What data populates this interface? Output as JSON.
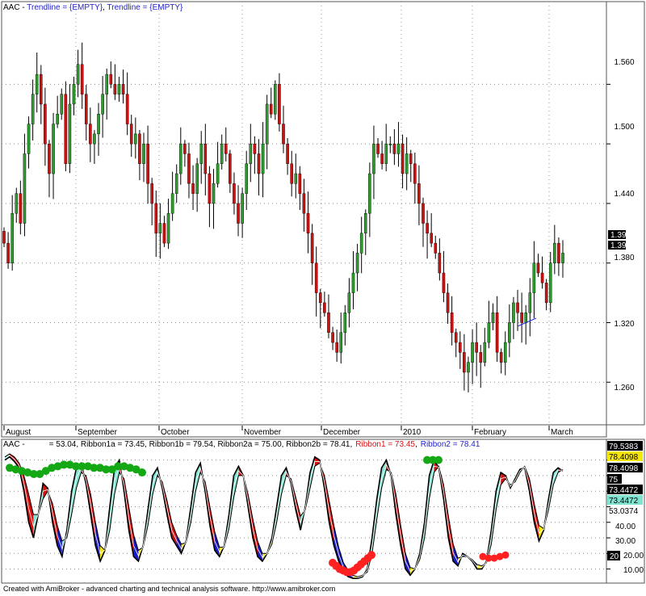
{
  "top_panel": {
    "symbol_label": "AAC - ",
    "trendline_text_1": "Trendline = {EMPTY}",
    "separator": ", ",
    "trendline_text_2": "Trendline = {EMPTY}",
    "price_labels": [
      "1.560",
      "1.500",
      "1.440",
      "1.380",
      "1.320",
      "1.260"
    ],
    "last_price_badges": [
      "1.39",
      "1.39"
    ],
    "x_labels": [
      "August",
      "September",
      "October",
      "November",
      "December",
      "2010",
      "February",
      "March"
    ]
  },
  "bottom_panel": {
    "header": {
      "prefix": "AAC -",
      "text_black": "= 53.04, Ribbon1a = 73.45, Ribbon1b = 79.54, Ribbon2a = 75.00, Ribbon2b = 78.41,",
      "ribbon1": "Ribbon1 = 73.45",
      "sep": ",",
      "ribbon2": "Ribbon2 = 78.41"
    },
    "value_badges": [
      "79.5383",
      "78.4098",
      "78.4098",
      "75",
      "73.4472",
      "73.4472",
      "53.0374"
    ],
    "scale_labels": [
      "40.00",
      "30.00",
      "20.00",
      "10.00"
    ],
    "level_badge": "20"
  },
  "footer": {
    "text": "Created with AmiBroker - advanced charting and technical analysis software. http://www.amibroker.com"
  },
  "colors": {
    "up": "#2e9b2e",
    "down": "#cc1111",
    "ribbon_cyan": "#7fe3cf",
    "ribbon_yellow": "#f5e60c",
    "ribbon_blue": "#1b1bc4",
    "ribbon_red": "#d41010",
    "green_dots": "#15a815",
    "red_dots": "#ff2020"
  },
  "chart_data": [
    {
      "type": "candlestick",
      "title": "AAC",
      "yrange": [
        1.222,
        1.64
      ],
      "y_ticks": [
        1.56,
        1.5,
        1.44,
        1.38,
        1.32,
        1.26
      ],
      "x_labels": [
        "August",
        "September",
        "October",
        "November",
        "December",
        "2010",
        "February",
        "March"
      ],
      "series": [
        {
          "name": "price",
          "close": [
            1.4,
            1.38,
            1.43,
            1.45,
            1.42,
            1.49,
            1.52,
            1.55,
            1.57,
            1.54,
            1.5,
            1.47,
            1.52,
            1.53,
            1.55,
            1.48,
            1.54,
            1.56,
            1.58,
            1.55,
            1.52,
            1.5,
            1.51,
            1.53,
            1.55,
            1.57,
            1.56,
            1.55,
            1.56,
            1.55,
            1.52,
            1.5,
            1.51,
            1.48,
            1.5,
            1.46,
            1.44,
            1.41,
            1.42,
            1.4,
            1.43,
            1.45,
            1.47,
            1.5,
            1.49,
            1.46,
            1.45,
            1.48,
            1.5,
            1.47,
            1.44,
            1.46,
            1.48,
            1.5,
            1.49,
            1.46,
            1.44,
            1.42,
            1.45,
            1.48,
            1.5,
            1.49,
            1.47,
            1.5,
            1.54,
            1.53,
            1.56,
            1.52,
            1.5,
            1.48,
            1.46,
            1.47,
            1.45,
            1.43,
            1.41,
            1.38,
            1.35,
            1.34,
            1.33,
            1.31,
            1.3,
            1.29,
            1.31,
            1.33,
            1.35,
            1.37,
            1.39,
            1.41,
            1.43,
            1.47,
            1.5,
            1.49,
            1.48,
            1.5,
            1.5,
            1.49,
            1.5,
            1.47,
            1.49,
            1.48,
            1.46,
            1.44,
            1.42,
            1.41,
            1.4,
            1.39,
            1.37,
            1.35,
            1.33,
            1.31,
            1.3,
            1.29,
            1.27,
            1.28,
            1.3,
            1.29,
            1.28,
            1.3,
            1.32,
            1.33,
            1.29,
            1.28,
            1.3,
            1.32,
            1.34,
            1.33,
            1.32,
            1.33,
            1.35,
            1.38,
            1.37,
            1.36,
            1.34,
            1.38,
            1.4,
            1.38,
            1.39
          ]
        }
      ]
    },
    {
      "type": "line",
      "title": "AAC",
      "yrange": [
        2,
        85
      ],
      "y_ticks": [
        40,
        30,
        20,
        10
      ],
      "series": [
        {
          "name": "Ribbon1",
          "values": [
            80,
            82,
            79,
            75,
            60,
            40,
            30,
            45,
            65,
            62,
            40,
            25,
            18,
            35,
            60,
            75,
            78,
            65,
            45,
            25,
            15,
            22,
            50,
            75,
            80,
            60,
            35,
            18,
            15,
            25,
            48,
            70,
            75,
            62,
            45,
            30,
            25,
            20,
            28,
            50,
            72,
            78,
            60,
            38,
            22,
            18,
            25,
            45,
            70,
            76,
            70,
            50,
            30,
            18,
            15,
            20,
            30,
            50,
            70,
            75,
            65,
            48,
            35,
            50,
            72,
            82,
            80,
            62,
            40,
            25,
            15,
            8,
            5,
            4,
            4,
            5,
            10,
            30,
            55,
            75,
            80,
            70,
            45,
            25,
            10,
            6,
            10,
            20,
            40,
            70,
            80,
            75,
            55,
            30,
            15,
            12,
            20,
            18,
            15,
            10,
            10,
            15,
            35,
            60,
            72,
            70,
            62,
            68,
            74,
            75,
            60,
            40,
            28,
            35,
            55,
            72,
            75,
            73
          ]
        },
        {
          "name": "Ribbon2",
          "values": [
            82,
            84,
            82,
            78,
            70,
            58,
            45,
            45,
            55,
            60,
            52,
            38,
            28,
            30,
            45,
            62,
            72,
            70,
            58,
            40,
            25,
            22,
            35,
            58,
            72,
            68,
            50,
            32,
            22,
            24,
            38,
            58,
            70,
            66,
            54,
            40,
            32,
            26,
            27,
            40,
            60,
            72,
            66,
            50,
            34,
            24,
            24,
            36,
            56,
            70,
            70,
            58,
            42,
            28,
            20,
            20,
            26,
            40,
            58,
            70,
            68,
            56,
            44,
            48,
            62,
            76,
            78,
            70,
            54,
            38,
            24,
            14,
            9,
            6,
            5,
            6,
            8,
            20,
            42,
            62,
            74,
            72,
            58,
            38,
            20,
            11,
            10,
            16,
            30,
            55,
            72,
            76,
            64,
            44,
            26,
            17,
            18,
            18,
            16,
            13,
            12,
            14,
            26,
            48,
            64,
            68,
            64,
            66,
            72,
            76,
            68,
            52,
            38,
            36,
            48,
            64,
            72,
            74
          ]
        },
        {
          "name": "Ribbon1a/1b dots (green)",
          "values": [
            75,
            74,
            73,
            72,
            71,
            71,
            73,
            75,
            76,
            77,
            77,
            76,
            76,
            76,
            75,
            75,
            74,
            74,
            76,
            76,
            75,
            74,
            72
          ]
        },
        {
          "name": "Ribbon2a/2b dots (red)",
          "values": [
            14,
            12,
            10,
            9,
            8,
            8,
            9,
            11,
            13,
            15,
            17,
            19
          ]
        }
      ],
      "last_values": {
        "value": 53.04,
        "Ribbon1a": 73.45,
        "Ribbon1b": 79.54,
        "Ribbon2a": 75.0,
        "Ribbon2b": 78.41,
        "Ribbon1": 73.45,
        "Ribbon2": 78.41
      }
    }
  ]
}
